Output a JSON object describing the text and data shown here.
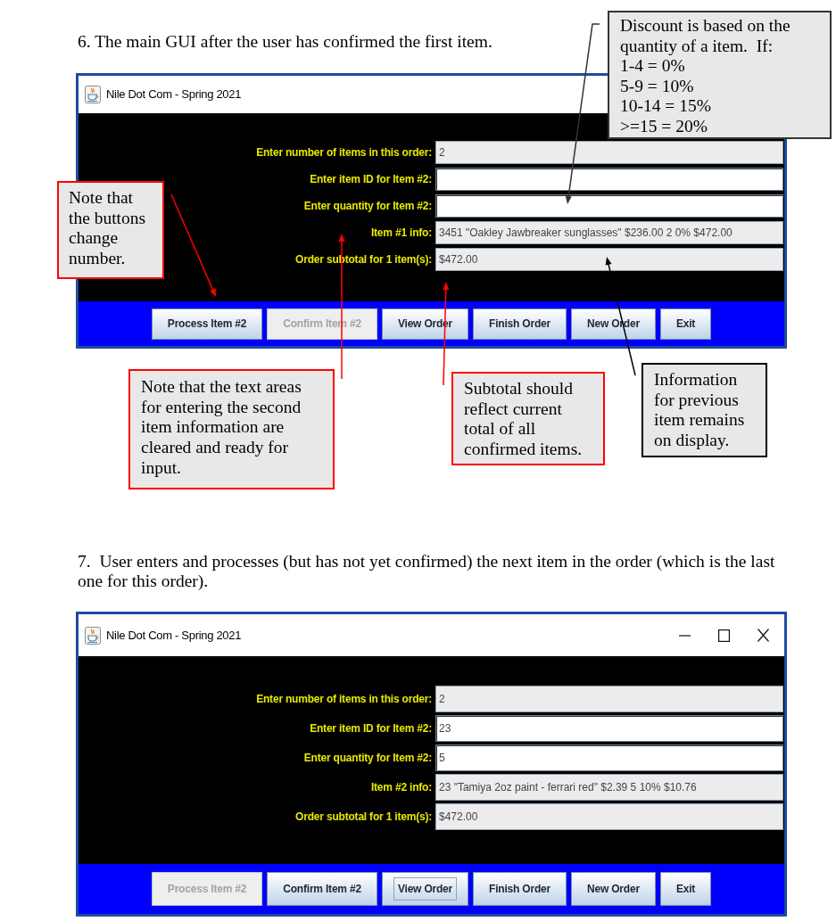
{
  "figures": [
    {
      "caption": "6. The main GUI after the user has confirmed the first item.",
      "window": {
        "title": "Nile Dot Com - Spring 2021",
        "fields": [
          {
            "label": "Enter number of items in this order:",
            "value": "2",
            "editable": false
          },
          {
            "label": "Enter item ID for Item #2:",
            "editable": true
          },
          {
            "label": "Enter quantity for Item #2:",
            "editable": true
          },
          {
            "label": "Item #1 info:",
            "value": "3451 \"Oakley Jawbreaker sunglasses\" $236.00 2 0% $472.00",
            "editable": false
          },
          {
            "label": "Order subtotal for 1 item(s):",
            "value": "$472.00",
            "editable": false
          }
        ],
        "buttons": [
          {
            "label": "Process Item #2",
            "disabled": false,
            "focused": false
          },
          {
            "label": "Confirm Item #2",
            "disabled": true,
            "focused": false
          },
          {
            "label": "View Order",
            "disabled": false,
            "focused": false
          },
          {
            "label": "Finish Order",
            "disabled": false,
            "focused": false
          },
          {
            "label": "New Order",
            "disabled": false,
            "focused": false
          },
          {
            "label": "Exit",
            "disabled": false,
            "focused": false
          }
        ]
      },
      "callouts": [
        {
          "text": "Discount is based on the\nquantity of a item.  If:\n1-4 = 0%\n5-9 = 10%\n10-14 = 15%\n>=15 = 20%",
          "color": "#333333"
        },
        {
          "text": "Note that\nthe buttons\nchange\nnumber.",
          "color": "#ff0000"
        },
        {
          "text": "Note that the text areas\nfor entering the second\nitem information are\ncleared and ready for\ninput.",
          "color": "#ff0000"
        },
        {
          "text": "Subtotal should\nreflect current\ntotal of all\nconfirmed items.",
          "color": "#ff0000"
        },
        {
          "text": "Information\nfor previous\nitem remains\non display.",
          "color": "#000000"
        }
      ]
    },
    {
      "caption": "7.  User enters and processes (but has not yet confirmed) the next item in the order (which is the last one for this order).",
      "window": {
        "title": "Nile Dot Com - Spring 2021",
        "title_buttons": true,
        "fields": [
          {
            "label": "Enter number of items in this order:",
            "value": "2",
            "editable": false
          },
          {
            "label": "Enter item ID for Item #2:",
            "value": "23",
            "editable": true
          },
          {
            "label": "Enter quantity for Item #2:",
            "value": "5",
            "editable": true
          },
          {
            "label": "Item #2 info:",
            "value": "23 \"Tamiya 2oz paint - ferrari red\" $2.39 5 10% $10.76",
            "editable": false
          },
          {
            "label": "Order subtotal for 1 item(s):",
            "value": "$472.00",
            "editable": false
          }
        ],
        "buttons": [
          {
            "label": "Process Item #2",
            "disabled": true,
            "focused": false
          },
          {
            "label": "Confirm Item #2",
            "disabled": false,
            "focused": false
          },
          {
            "label": "View Order",
            "disabled": false,
            "focused": true
          },
          {
            "label": "Finish Order",
            "disabled": false,
            "focused": false
          },
          {
            "label": "New Order",
            "disabled": false,
            "focused": false
          },
          {
            "label": "Exit",
            "disabled": false,
            "focused": false
          }
        ]
      }
    }
  ]
}
